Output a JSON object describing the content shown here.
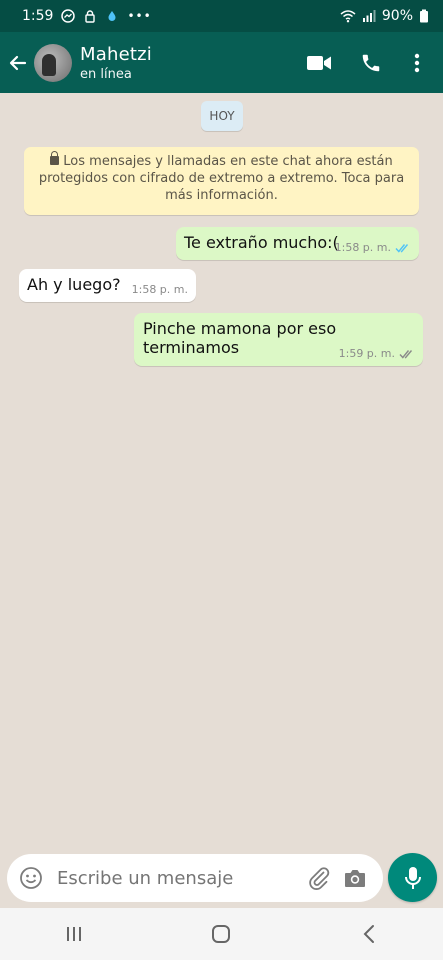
{
  "status_bar": {
    "time": "1:59",
    "more": "•••",
    "battery": "90%"
  },
  "header": {
    "name": "Mahetzi",
    "status": "en línea"
  },
  "chat": {
    "date_chip": "HOY",
    "encryption_notice": "Los mensajes y llamadas en este chat ahora están protegidos con cifrado de extremo a extremo. Toca para más información.",
    "messages": [
      {
        "direction": "outgoing",
        "text": "Te extraño mucho:(",
        "time": "1:58 p. m.",
        "ticks": "read"
      },
      {
        "direction": "incoming",
        "text": "Ah y luego?",
        "time": "1:58 p. m."
      },
      {
        "direction": "outgoing",
        "text": "Pinche mamona por eso terminamos",
        "time": "1:59 p. m.",
        "ticks": "delivered"
      }
    ]
  },
  "composer": {
    "placeholder": "Escribe un mensaje"
  },
  "icons": {
    "back": "back-arrow-icon",
    "video": "video-call-icon",
    "call": "phone-call-icon",
    "menu": "more-vert-icon",
    "emoji": "emoji-icon",
    "attach": "paperclip-icon",
    "camera": "camera-icon",
    "mic": "mic-icon"
  },
  "colors": {
    "header": "#075e54",
    "statusbar": "#054d44",
    "outgoing": "#dcf8c6",
    "incoming": "#ffffff",
    "accent": "#00897b",
    "read_tick": "#4fc3f7"
  }
}
